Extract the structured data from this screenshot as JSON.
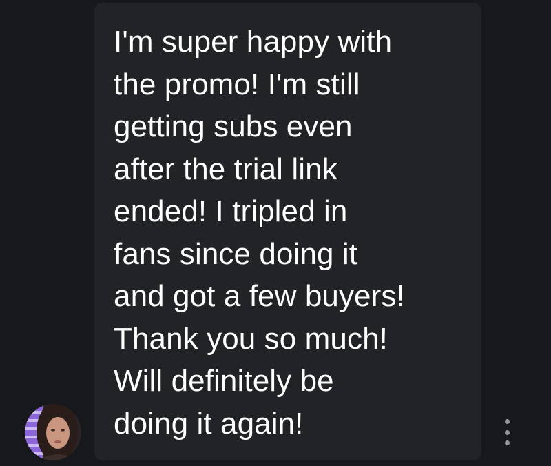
{
  "message": {
    "text": "I'm super happy with\nthe promo! I'm still\ngetting subs even\nafter the trial link\nended! I tripled in\nfans since doing it\nand got a few buyers!\nThank you so much!\nWill definitely be\ndoing it again!"
  },
  "sender": {
    "avatar_icon": "user-avatar-photo"
  },
  "actions": {
    "more_icon": "more-vertical-icon"
  },
  "colors": {
    "background": "#17181c",
    "bubble": "#212327",
    "text": "#ffffff",
    "accent": "#8b6bd6"
  }
}
